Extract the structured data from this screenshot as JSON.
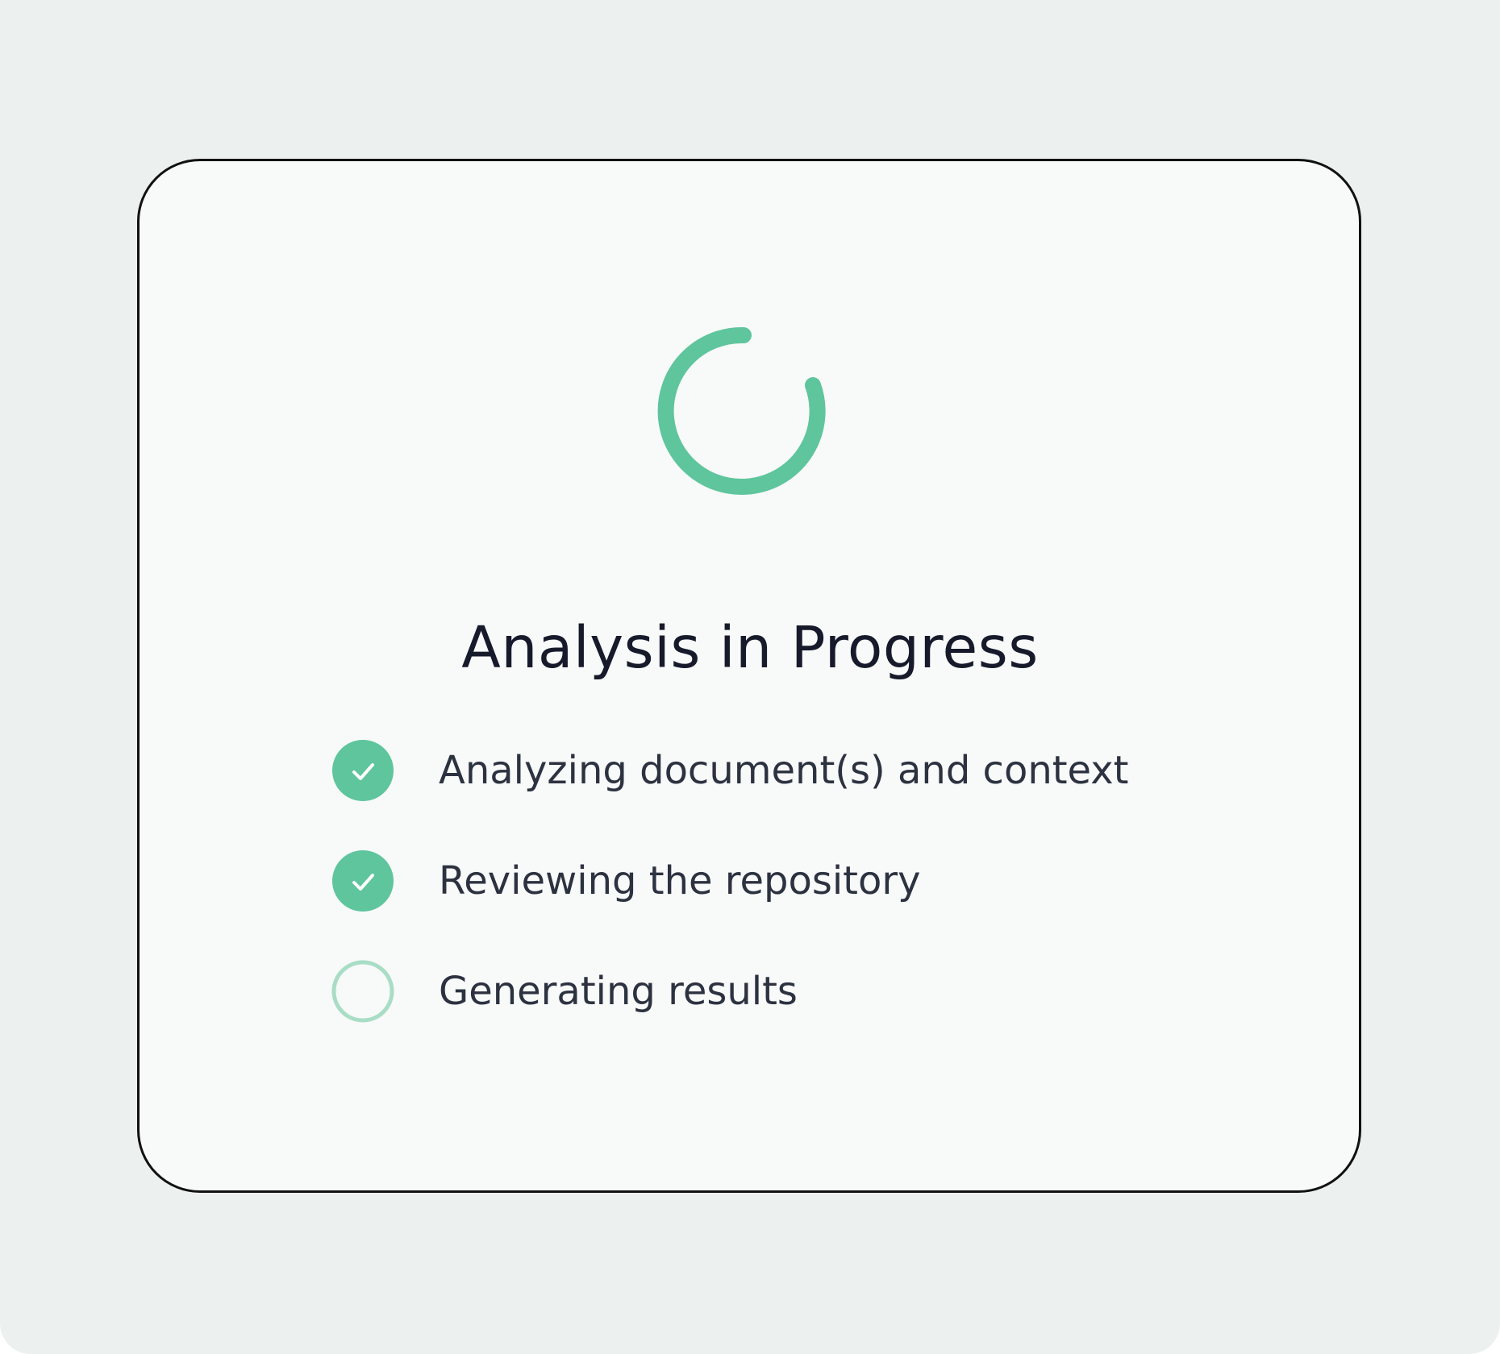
{
  "app": {
    "title": "Analysis in Progress",
    "spinner_icon": "loading-spinner-icon",
    "accent_color": "#5ec59d",
    "pending_color": "#a8ddc6"
  },
  "steps": [
    {
      "label": "Analyzing document(s) and context",
      "status": "completed",
      "icon": "check-circle-icon"
    },
    {
      "label": "Reviewing the repository",
      "status": "completed",
      "icon": "check-circle-icon"
    },
    {
      "label": "Generating results",
      "status": "pending",
      "icon": "empty-circle-icon"
    }
  ]
}
